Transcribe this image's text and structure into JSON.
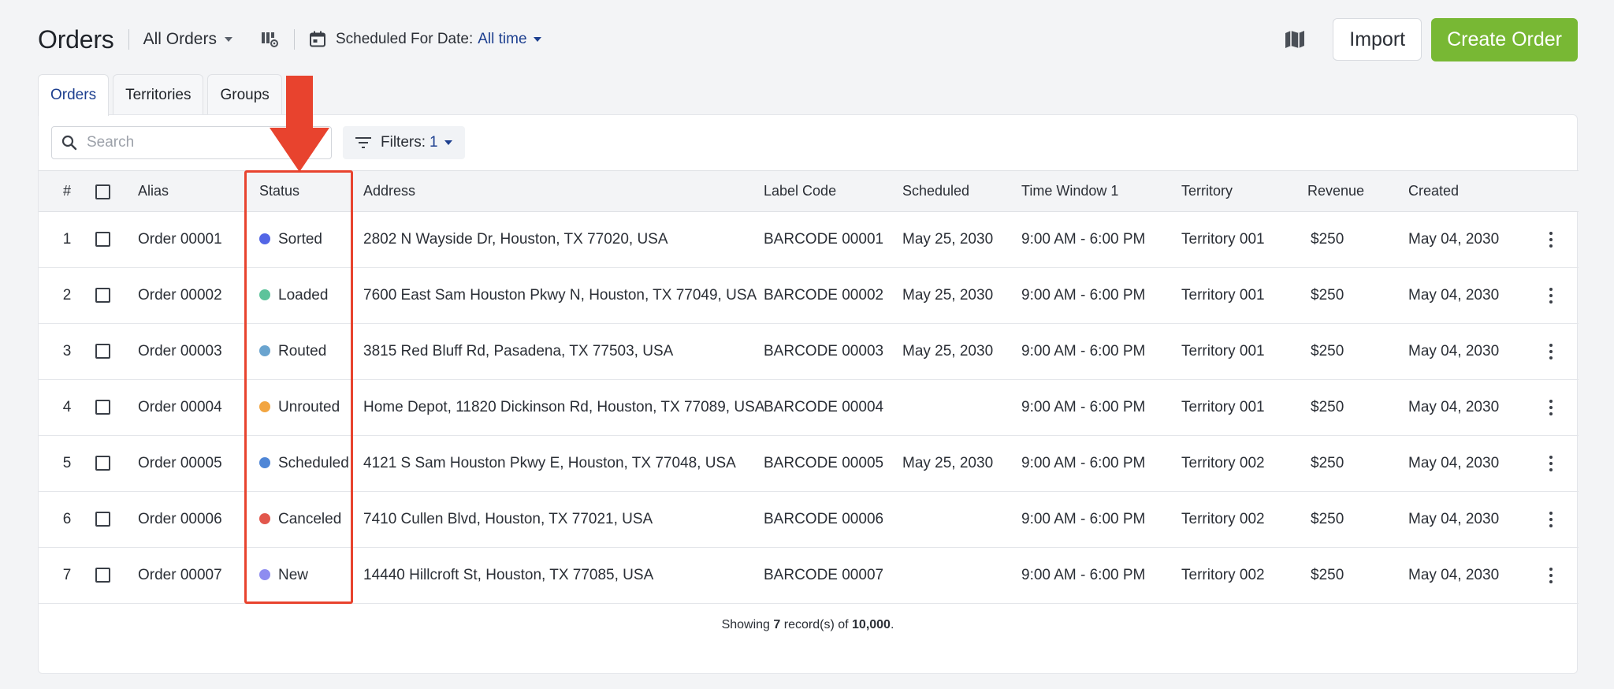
{
  "header": {
    "title": "Orders",
    "view": "All Orders",
    "date_filter_label": "Scheduled For Date:",
    "date_filter_value": "All time",
    "import_label": "Import",
    "create_label": "Create Order"
  },
  "tabs": [
    {
      "label": "Orders",
      "active": true
    },
    {
      "label": "Territories",
      "active": false
    },
    {
      "label": "Groups",
      "active": false
    }
  ],
  "toolbar": {
    "search_placeholder": "Search",
    "filters_label": "Filters:",
    "filters_count": "1"
  },
  "table": {
    "columns": [
      "#",
      "Alias",
      "Status",
      "Address",
      "Label Code",
      "Scheduled",
      "Time Window 1",
      "Territory",
      "Revenue",
      "Created"
    ],
    "rows": [
      {
        "num": "1",
        "alias": "Order 00001",
        "status": "Sorted",
        "status_color": "#5366e6",
        "address": "2802 N Wayside Dr, Houston, TX 77020, USA",
        "label_code": "BARCODE 00001",
        "scheduled": "May 25, 2030",
        "time_window": "9:00 AM - 6:00 PM",
        "territory": "Territory 001",
        "revenue": "$250",
        "created": "May 04, 2030"
      },
      {
        "num": "2",
        "alias": "Order 00002",
        "status": "Loaded",
        "status_color": "#5dc39b",
        "address": "7600 East Sam Houston Pkwy N, Houston, TX 77049, USA",
        "label_code": "BARCODE 00002",
        "scheduled": "May 25, 2030",
        "time_window": "9:00 AM - 6:00 PM",
        "territory": "Territory 001",
        "revenue": "$250",
        "created": "May 04, 2030"
      },
      {
        "num": "3",
        "alias": "Order 00003",
        "status": "Routed",
        "status_color": "#6aa4cf",
        "address": "3815 Red Bluff Rd, Pasadena, TX 77503, USA",
        "label_code": "BARCODE 00003",
        "scheduled": "May 25, 2030",
        "time_window": "9:00 AM - 6:00 PM",
        "territory": "Territory 001",
        "revenue": "$250",
        "created": "May 04, 2030"
      },
      {
        "num": "4",
        "alias": "Order 00004",
        "status": "Unrouted",
        "status_color": "#f2a541",
        "address": "Home Depot, 11820 Dickinson Rd, Houston, TX 77089, USA",
        "label_code": "BARCODE 00004",
        "scheduled": "",
        "time_window": "9:00 AM - 6:00 PM",
        "territory": "Territory 001",
        "revenue": "$250",
        "created": "May 04, 2030"
      },
      {
        "num": "5",
        "alias": "Order 00005",
        "status": "Scheduled",
        "status_color": "#4f86d6",
        "address": "4121 S Sam Houston Pkwy E, Houston, TX 77048, USA",
        "label_code": "BARCODE 00005",
        "scheduled": "May 25, 2030",
        "time_window": "9:00 AM - 6:00 PM",
        "territory": "Territory 002",
        "revenue": "$250",
        "created": "May 04, 2030"
      },
      {
        "num": "6",
        "alias": "Order 00006",
        "status": "Canceled",
        "status_color": "#e2574c",
        "address": "7410 Cullen Blvd, Houston, TX 77021, USA",
        "label_code": "BARCODE 00006",
        "scheduled": "",
        "time_window": "9:00 AM - 6:00 PM",
        "territory": "Territory 002",
        "revenue": "$250",
        "created": "May 04, 2030"
      },
      {
        "num": "7",
        "alias": "Order 00007",
        "status": "New",
        "status_color": "#8e8cf0",
        "address": "14440 Hillcroft St, Houston, TX 77085, USA",
        "label_code": "BARCODE 00007",
        "scheduled": "",
        "time_window": "9:00 AM - 6:00 PM",
        "territory": "Territory 002",
        "revenue": "$250",
        "created": "May 04, 2030"
      }
    ]
  },
  "footer": {
    "prefix": "Showing",
    "shown": "7",
    "middle": "record(s) of",
    "total": "10,000",
    "suffix": "."
  },
  "colors": {
    "accent": "#1d3f8f",
    "create_button": "#78b834",
    "annotation": "#e8432e"
  },
  "icons": [
    "chevron-down-icon",
    "columns-settings-icon",
    "calendar-icon",
    "map-icon",
    "search-icon",
    "filter-icon",
    "checkbox-icon",
    "kebab-menu-icon",
    "down-arrow-annotation"
  ]
}
